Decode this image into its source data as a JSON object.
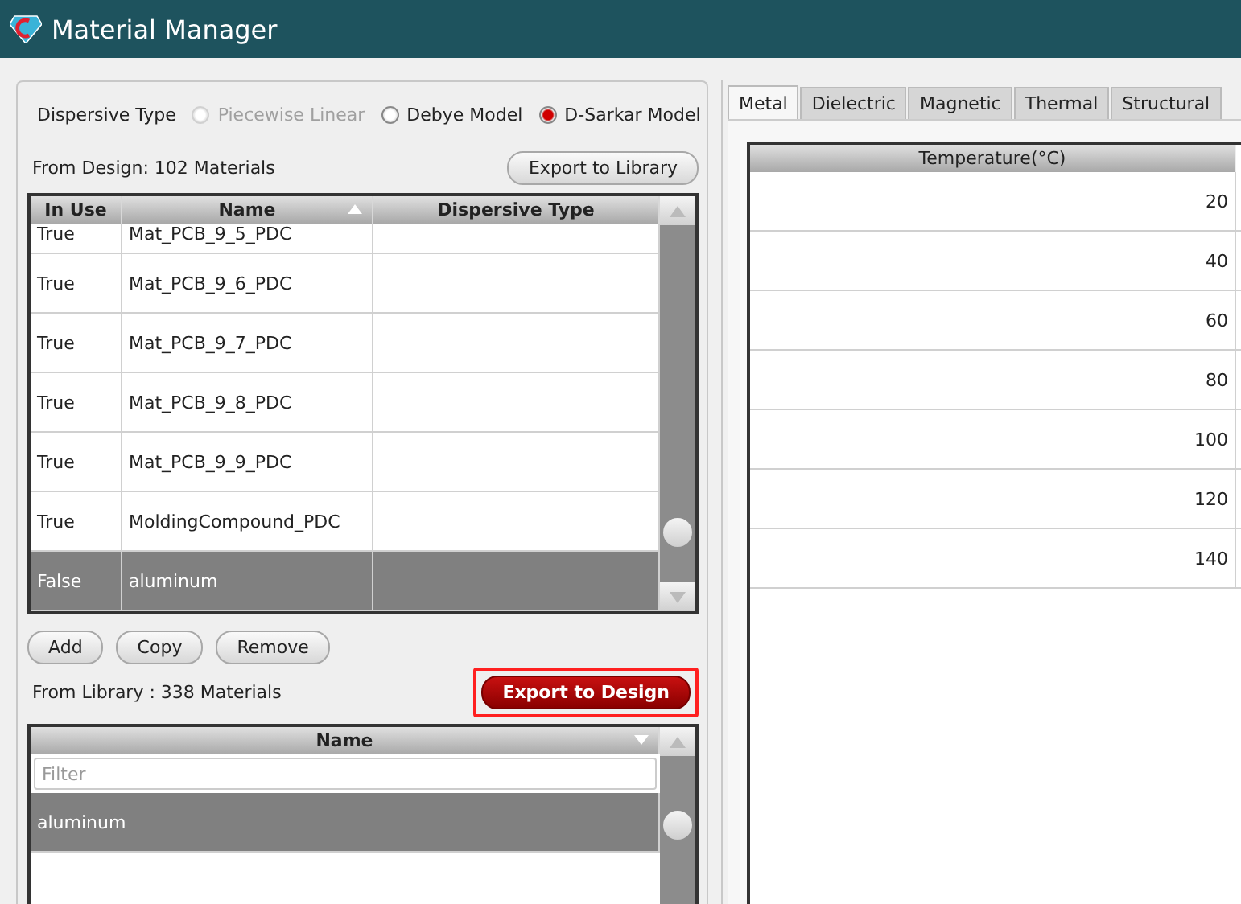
{
  "window": {
    "title": "Material Manager"
  },
  "dispersive_type": {
    "label": "Dispersive Type",
    "options": [
      {
        "label": "Piecewise Linear",
        "selected": false,
        "disabled": true
      },
      {
        "label": "Debye Model",
        "selected": false,
        "disabled": false
      },
      {
        "label": "D-Sarkar Model",
        "selected": true,
        "disabled": false
      }
    ]
  },
  "design": {
    "summary": "From Design: 102 Materials",
    "export_button": "Export to Library",
    "columns": [
      "In Use",
      "Name",
      "Dispersive Type"
    ],
    "rows": [
      {
        "in_use": "True",
        "name": "Mat_PCB_9_5_PDC",
        "selected": false
      },
      {
        "in_use": "True",
        "name": "Mat_PCB_9_6_PDC",
        "selected": false
      },
      {
        "in_use": "True",
        "name": "Mat_PCB_9_7_PDC",
        "selected": false
      },
      {
        "in_use": "True",
        "name": "Mat_PCB_9_8_PDC",
        "selected": false
      },
      {
        "in_use": "True",
        "name": "Mat_PCB_9_9_PDC",
        "selected": false
      },
      {
        "in_use": "True",
        "name": "MoldingCompound_PDC",
        "selected": false
      },
      {
        "in_use": "False",
        "name": "aluminum",
        "selected": true
      }
    ],
    "buttons": [
      "Add",
      "Copy",
      "Remove"
    ]
  },
  "library": {
    "summary": "From Library : 338 Materials",
    "export_button": "Export to Design",
    "export_highlighted": true,
    "column": "Name",
    "filter_placeholder": "Filter",
    "rows": [
      {
        "name": "aluminum",
        "selected": true
      }
    ]
  },
  "properties": {
    "tabs": [
      {
        "label": "Metal",
        "selected": true
      },
      {
        "label": "Dielectric",
        "selected": false
      },
      {
        "label": "Magnetic",
        "selected": false
      },
      {
        "label": "Thermal",
        "selected": false
      },
      {
        "label": "Structural",
        "selected": false
      }
    ],
    "column": "Temperature(°C)",
    "rows": [
      "20",
      "40",
      "60",
      "80",
      "100",
      "120",
      "140"
    ]
  }
}
